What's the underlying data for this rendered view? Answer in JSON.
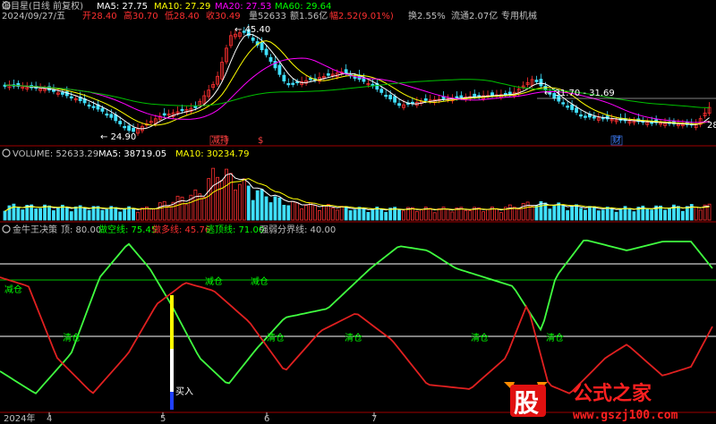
{
  "header": {
    "stock": "海目星(日线 前复权)",
    "ma": [
      {
        "label": "MA5: 27.75",
        "color": "#ffffff"
      },
      {
        "label": "MA10: 27.29",
        "color": "#ffff00"
      },
      {
        "label": "MA20: 27.53",
        "color": "#ff00ff"
      },
      {
        "label": "MA60: 29.64",
        "color": "#00ff00"
      }
    ]
  },
  "info_row": {
    "date": "2024/09/27/五",
    "open": "开28.40",
    "high": "高30.70",
    "low": "低28.40",
    "close": "收30.49",
    "volume": "量52633",
    "amount": "额1.56亿",
    "change": "幅2.52(9.01%)",
    "turnover": "换2.55%",
    "float": "流通2.07亿",
    "sector": "专用机械"
  },
  "price_annotations": {
    "high_label": "45.40",
    "low_label": "24.90",
    "range_label": "31.70 - 31.69",
    "right_edge": "28",
    "markers": [
      {
        "text": "减持",
        "color": "#ff4040"
      },
      {
        "text": "$",
        "color": "#ff4040"
      },
      {
        "text": "财",
        "color": "#4080ff"
      }
    ]
  },
  "volume_panel": {
    "icon": "gear",
    "label": "VOLUME: 52633.29",
    "ma5": "MA5: 38719.05",
    "ma10": "MA10: 30234.79"
  },
  "indicator_panel": {
    "title": "金牛王决策",
    "top": "顶: 80.00",
    "short_line": "做空线: 75.45",
    "long_line": "做多线: 45.76",
    "escape": "逃顶线: 71.00",
    "boundary": "强弱分界线: 40.00",
    "labels_reduce": [
      "减仓",
      "减仓",
      "减仓"
    ],
    "labels_clear": [
      "清仓",
      "清仓",
      "清仓",
      "清仓",
      "清仓"
    ],
    "buy": "买入"
  },
  "axis": {
    "year": "2024年",
    "months": [
      "4",
      "5",
      "6",
      "7"
    ]
  },
  "watermark": {
    "logo": "股",
    "brand": "公式之家",
    "url": "www.gszj100.com"
  },
  "colors": {
    "up": "#ff3030",
    "down": "#40e0ff",
    "bg": "#000000",
    "ma60": "#00c000"
  }
}
